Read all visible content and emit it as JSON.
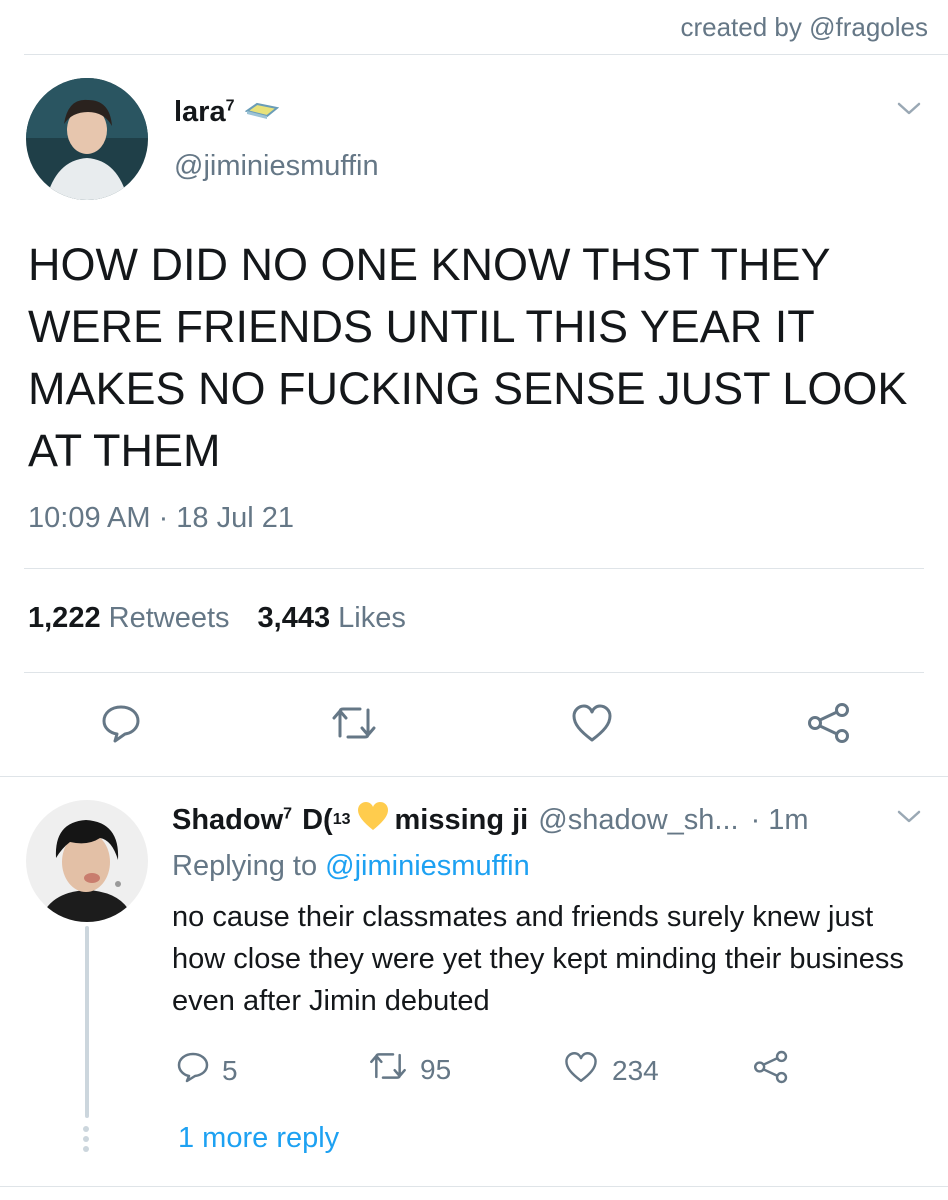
{
  "credit": "created by @fragoles",
  "tweet": {
    "display_name": "lara",
    "name_superscript": "7",
    "handle": "@jiminiesmuffin",
    "text": "HOW DID NO ONE KNOW THST THEY WERE FRIENDS UNTIL THIS YEAR IT MAKES NO FUCKING SENSE JUST LOOK AT THEM",
    "timestamp": "10:09 AM · 18 Jul 21",
    "retweets_count": "1,222",
    "retweets_label": "Retweets",
    "likes_count": "3,443",
    "likes_label": "Likes",
    "icons": [
      "reply-icon",
      "retweet-icon",
      "like-icon",
      "share-icon",
      "chevron-down-icon",
      "badge-icon"
    ]
  },
  "reply": {
    "display_name": "Shadow",
    "name_superscript": "7",
    "name_glyph": "D(",
    "name_subscript": "13",
    "name_suffix": "missing ji",
    "handle": "@shadow_sh...",
    "time": "· 1m",
    "replying_prefix": "Replying to",
    "replying_handle": "@jiminiesmuffin",
    "text": "no cause their classmates and friends surely knew just how close they were yet they kept minding their business even after Jimin debuted",
    "reply_count": "5",
    "retweet_count": "95",
    "like_count": "234",
    "more_reply": "1 more reply"
  },
  "colors": {
    "link": "#1da1f2",
    "muted": "#657786",
    "text": "#14171a",
    "divider": "#dfe4e8",
    "heart_emoji": "#ffcc4d"
  }
}
